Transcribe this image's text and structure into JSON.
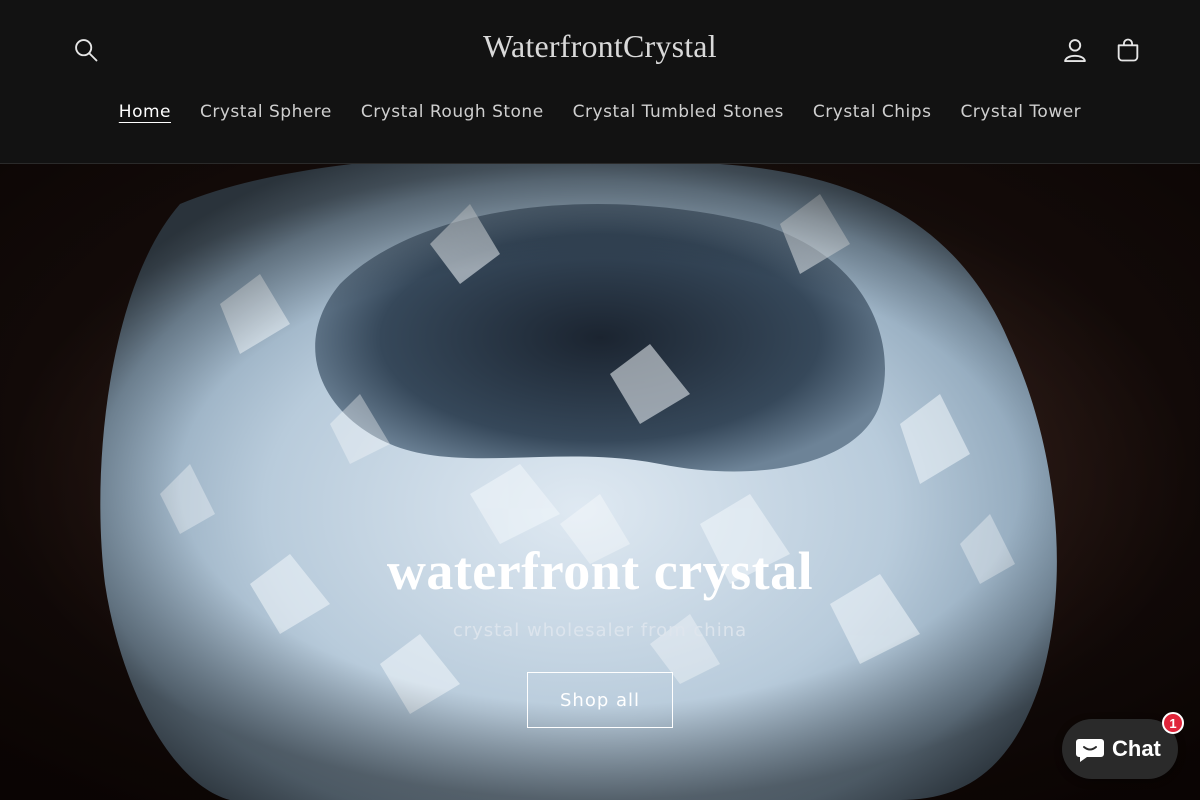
{
  "header": {
    "brand": "WaterfrontCrystal",
    "icons": [
      "search-icon",
      "account-icon",
      "cart-icon"
    ]
  },
  "nav": {
    "items": [
      {
        "label": "Home",
        "active": true
      },
      {
        "label": "Crystal Sphere"
      },
      {
        "label": "Crystal Rough Stone"
      },
      {
        "label": "Crystal Tumbled Stones"
      },
      {
        "label": "Crystal Chips"
      },
      {
        "label": "Crystal Tower"
      }
    ]
  },
  "hero": {
    "title": "waterfront crystal",
    "subtitle": "crystal wholesaler from china",
    "button_label": "Shop all"
  },
  "chat": {
    "label": "Chat",
    "badge_count": "1",
    "icon": "chat-bubble-icon"
  },
  "colors": {
    "header_bg": "#121212",
    "text": "#e6e6e6",
    "badge": "#e0243a"
  }
}
